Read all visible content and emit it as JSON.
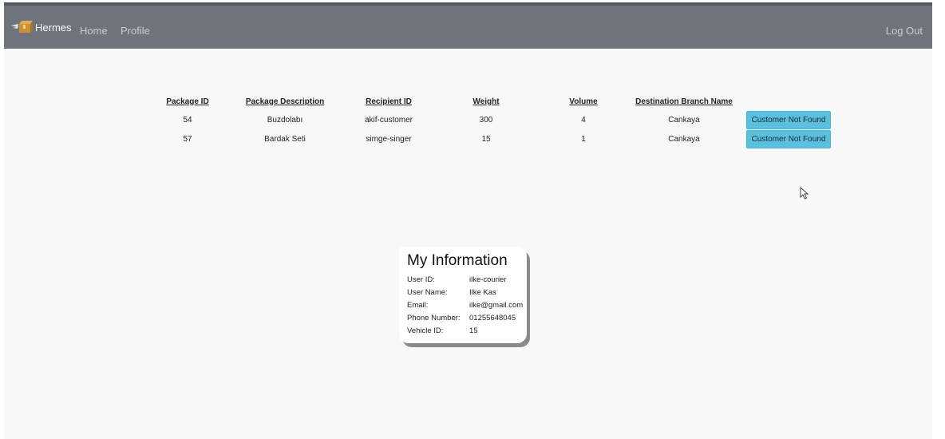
{
  "navbar": {
    "brand": "Hermes",
    "links": [
      "Home",
      "Profile"
    ],
    "logout": "Log Out"
  },
  "packages_table": {
    "headers": [
      "Package ID",
      "Package Description",
      "Recipient ID",
      "Weight",
      "Volume",
      "Destination Branch Name"
    ],
    "rows": [
      {
        "id": "54",
        "description": "Buzdolabı",
        "recipient": "akif-customer",
        "weight": "300",
        "volume": "4",
        "branch": "Cankaya",
        "action": "Customer Not Found"
      },
      {
        "id": "57",
        "description": "Bardak Seti",
        "recipient": "simge-singer",
        "weight": "15",
        "volume": "1",
        "branch": "Cankaya",
        "action": "Customer Not Found"
      }
    ]
  },
  "my_information": {
    "title": "My Information",
    "fields": [
      {
        "label": "User ID:",
        "value": "ilke-courier"
      },
      {
        "label": "User Name:",
        "value": "Ilke Kas"
      },
      {
        "label": "Email:",
        "value": "ilke@gmail.com"
      },
      {
        "label": "Phone Number:",
        "value": "01255648045"
      },
      {
        "label": "Vehicle ID:",
        "value": "15"
      }
    ]
  },
  "colors": {
    "navbar": "#6f737c",
    "button": "#5bc0de"
  },
  "icons": {
    "brand_logo": "winged-box-icon",
    "cursor": "mouse-pointer-icon"
  }
}
